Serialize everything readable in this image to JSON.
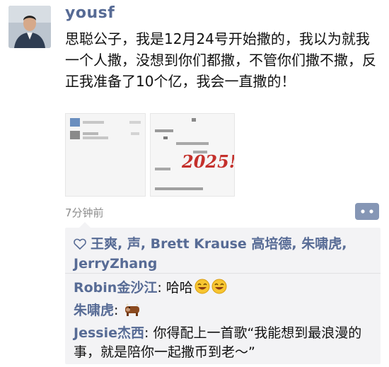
{
  "post": {
    "username": "yousf",
    "text": "思聪公子，我是12月24号开始撒的，我以为就我一个人撒，没想到你们都撒，不管你们撒不撒，反正我准备了10个亿，我会一直撒的！",
    "time_ago": "7分钟前",
    "handwritten_note": "2025!!!"
  },
  "likes": {
    "names": "王爽, 声, Brett Krause 高培德, 朱啸虎, JerryZhang"
  },
  "comments": [
    {
      "author": "Robin金沙江",
      "separator": ": ",
      "text": "哈哈"
    },
    {
      "author": "朱啸虎",
      "separator": ": ",
      "text": ""
    },
    {
      "author": "Jessie杰西",
      "separator": ": ",
      "text": "你得配上一首歌“我能想到最浪漫的事，就是陪你一起撒币到老～”"
    }
  ],
  "colors": {
    "link": "#576b95",
    "bg_interactions": "#f3f3f5"
  },
  "icons": [
    "heart-outline-icon",
    "comment-more-icon",
    "grin-emoji-icon",
    "cow-emoji-icon"
  ]
}
